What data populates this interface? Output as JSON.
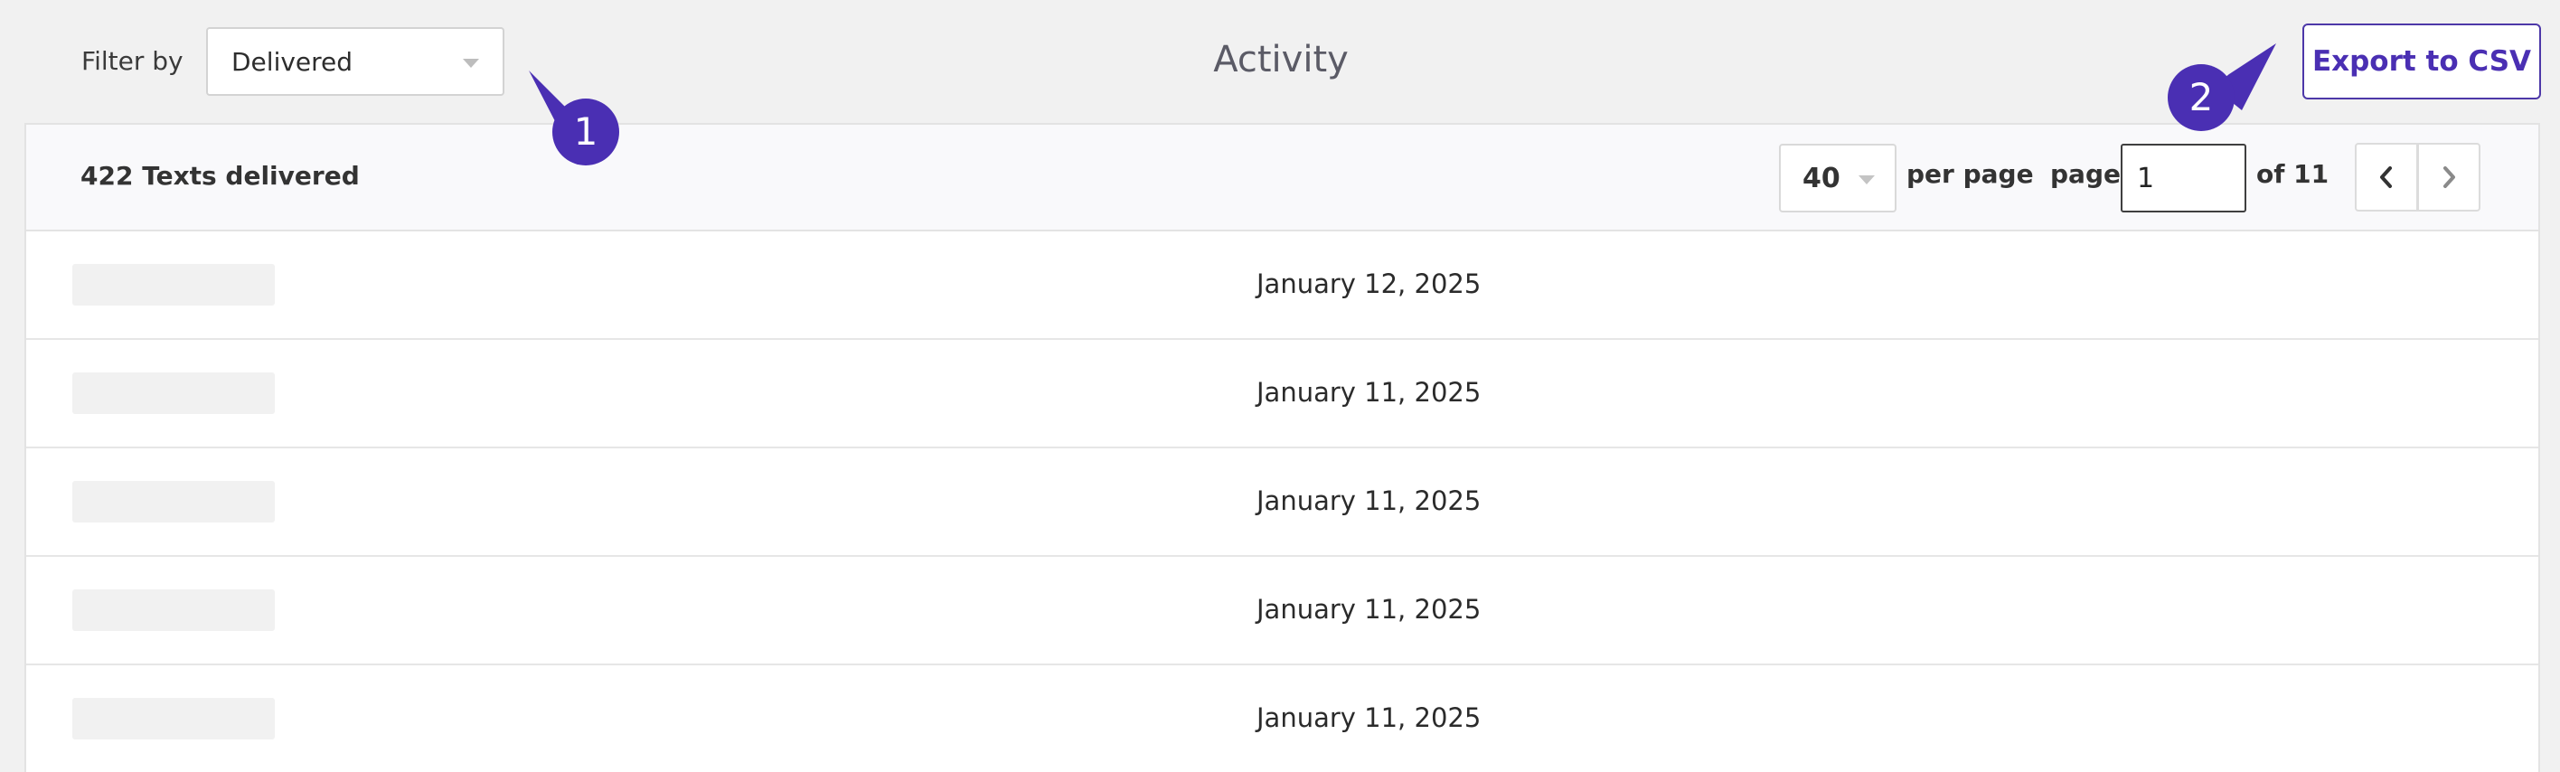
{
  "header": {
    "filter_label": "Filter by",
    "filter_value": "Delivered",
    "title": "Activity",
    "export_label": "Export to CSV"
  },
  "callouts": [
    "1",
    "2"
  ],
  "toolbar": {
    "count_label": "422 Texts delivered",
    "per_page_value": "40",
    "per_page_label": "per page",
    "page_label": "page",
    "page_value": "1",
    "page_of_label": "of 11"
  },
  "rows": [
    {
      "date": "January 12, 2025"
    },
    {
      "date": "January 11, 2025"
    },
    {
      "date": "January 11, 2025"
    },
    {
      "date": "January 11, 2025"
    },
    {
      "date": "January 11, 2025"
    }
  ],
  "colors": {
    "accent": "#4a2fb3",
    "callout": "#4a2fb3",
    "background": "#f1f1f1"
  }
}
